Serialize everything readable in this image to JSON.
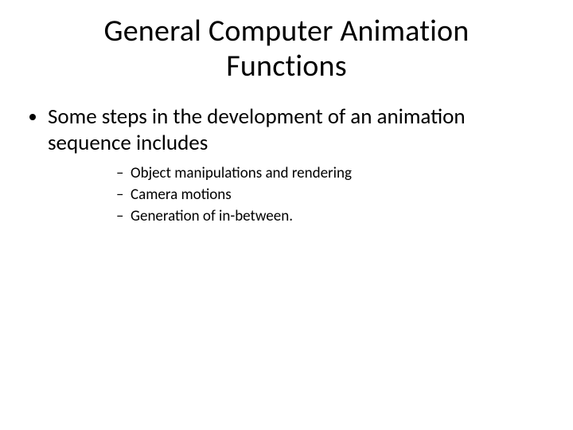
{
  "title_line1": "General Computer Animation",
  "title_line2": "Functions",
  "bullet1": "Some steps in the development of an animation sequence includes",
  "sub1": "Object manipulations and rendering",
  "sub2": "Camera motions",
  "sub3": "Generation of in-between."
}
